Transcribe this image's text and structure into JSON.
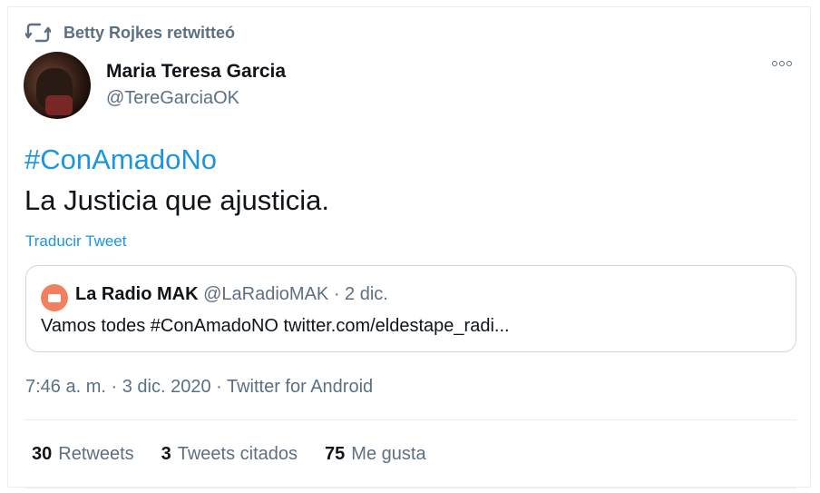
{
  "retweet": {
    "icon": "retweet-icon",
    "text": "Betty Rojkes retwitteó"
  },
  "author": {
    "name": "Maria Teresa Garcia",
    "handle": "@TereGarciaOK"
  },
  "tweet": {
    "hashtag": "#ConAmadoNo",
    "text": "La Justicia que ajusticia.",
    "translate_label": "Traducir Tweet",
    "timestamp": "7:46 a. m. · 3 dic. 2020 · Twitter for Android"
  },
  "quote": {
    "name": "La Radio MAK",
    "meta": "@LaRadioMAK · 2 dic.",
    "text": "Vamos todes #ConAmadoNO twitter.com/eldestape_radi..."
  },
  "stats": [
    {
      "count": "30",
      "label": "Retweets"
    },
    {
      "count": "3",
      "label": "Tweets citados"
    },
    {
      "count": "75",
      "label": "Me gusta"
    }
  ],
  "colors": {
    "link": "#1b95e0",
    "secondary_text": "#5b7083",
    "primary_text": "#0f1419",
    "border": "#ccd6dd"
  }
}
